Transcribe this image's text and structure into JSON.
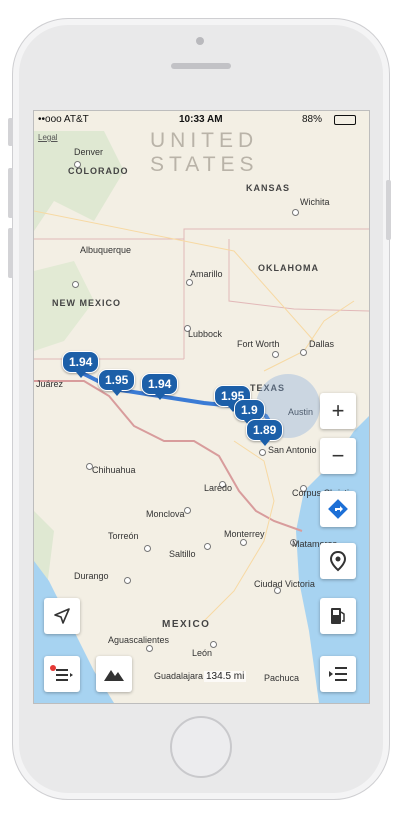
{
  "status_bar": {
    "carrier": "••ooo AT&T",
    "time": "10:33 AM",
    "battery": "88%"
  },
  "map": {
    "legal": "Legal",
    "country_label": "UNITED STATES",
    "mexico_label": "MEXICO",
    "states": [
      "COLORADO",
      "KANSAS",
      "OKLAHOMA",
      "NEW MEXICO",
      "TEXAS"
    ],
    "cities": [
      "Denver",
      "Wichita",
      "Albuquerque",
      "Amarillo",
      "Lubbock",
      "Fort Worth",
      "Dallas",
      "Austin",
      "San Antonio",
      "Juárez",
      "Chihuahua",
      "Laredo",
      "Monclova",
      "Torreón",
      "Saltillo",
      "Monterrey",
      "Corpus Christi",
      "Matamoros",
      "Durango",
      "Ciudad Victoria",
      "Aguascalientes",
      "León",
      "Guadalajara",
      "Pachuca"
    ],
    "scale": "134.5 mi"
  },
  "prices": [
    "1.94",
    "1.95",
    "1.94",
    "1.95",
    "1.9",
    "1.89"
  ],
  "controls": {
    "zoom_in": "+",
    "zoom_out": "−"
  }
}
